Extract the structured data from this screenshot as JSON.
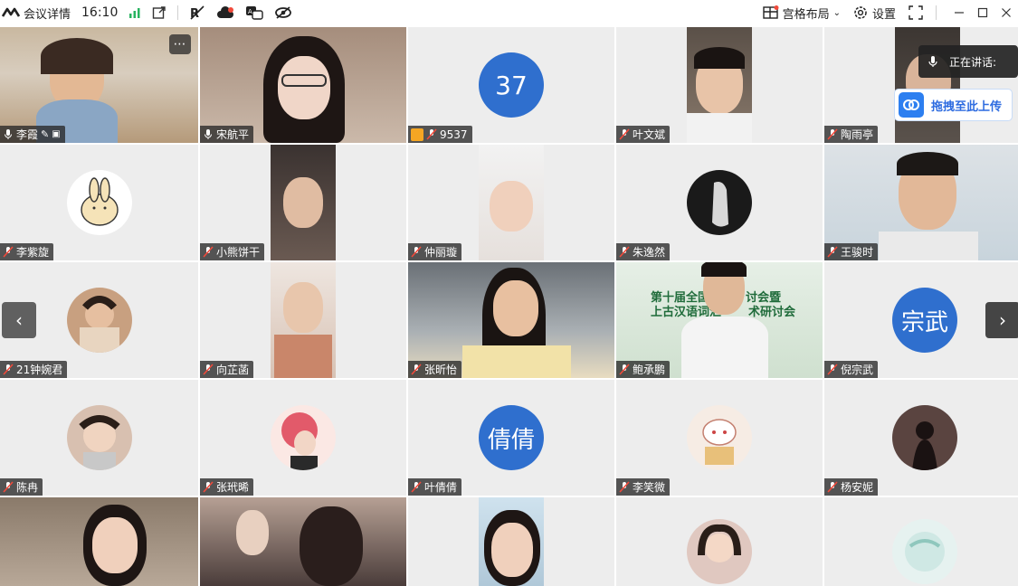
{
  "topbar": {
    "meeting_details": "会议详情",
    "time": "16:10",
    "layout_label": "宫格布局",
    "settings_label": "设置"
  },
  "speaking": {
    "label": "正在讲话:"
  },
  "upload": {
    "label": "拖拽至此上传"
  },
  "tiles": [
    {
      "name": "李霞"
    },
    {
      "name": "宋航平"
    },
    {
      "name": "9537",
      "initials": "37"
    },
    {
      "name": "叶文斌"
    },
    {
      "name": "陶雨亭"
    },
    {
      "name": "李紫旋"
    },
    {
      "name": "小熊饼干"
    },
    {
      "name": "仲丽璇"
    },
    {
      "name": "朱逸然"
    },
    {
      "name": "王骏时"
    },
    {
      "name": "21钟婉君"
    },
    {
      "name": "向芷菡"
    },
    {
      "name": "张昕怡"
    },
    {
      "name": "鲍承鹏"
    },
    {
      "name": "倪宗武",
      "initials": "宗武"
    },
    {
      "name": "陈冉"
    },
    {
      "name": "张玳晞"
    },
    {
      "name": "叶倩倩",
      "initials": "倩倩"
    },
    {
      "name": "李笑微"
    },
    {
      "name": "杨安妮"
    },
    {
      "name": ""
    },
    {
      "name": ""
    },
    {
      "name": ""
    },
    {
      "name": ""
    },
    {
      "name": ""
    }
  ],
  "banner_text": {
    "line1": "第十届全国",
    "line1b": "讨会暨",
    "line2": "上古汉语词汇",
    "line2b": "术研讨会"
  },
  "colors": {
    "active_border": "#3fc08b",
    "avatar_blue": "#2f6fce",
    "tag_bg": "#282828",
    "accent": "#2d7ff0"
  }
}
